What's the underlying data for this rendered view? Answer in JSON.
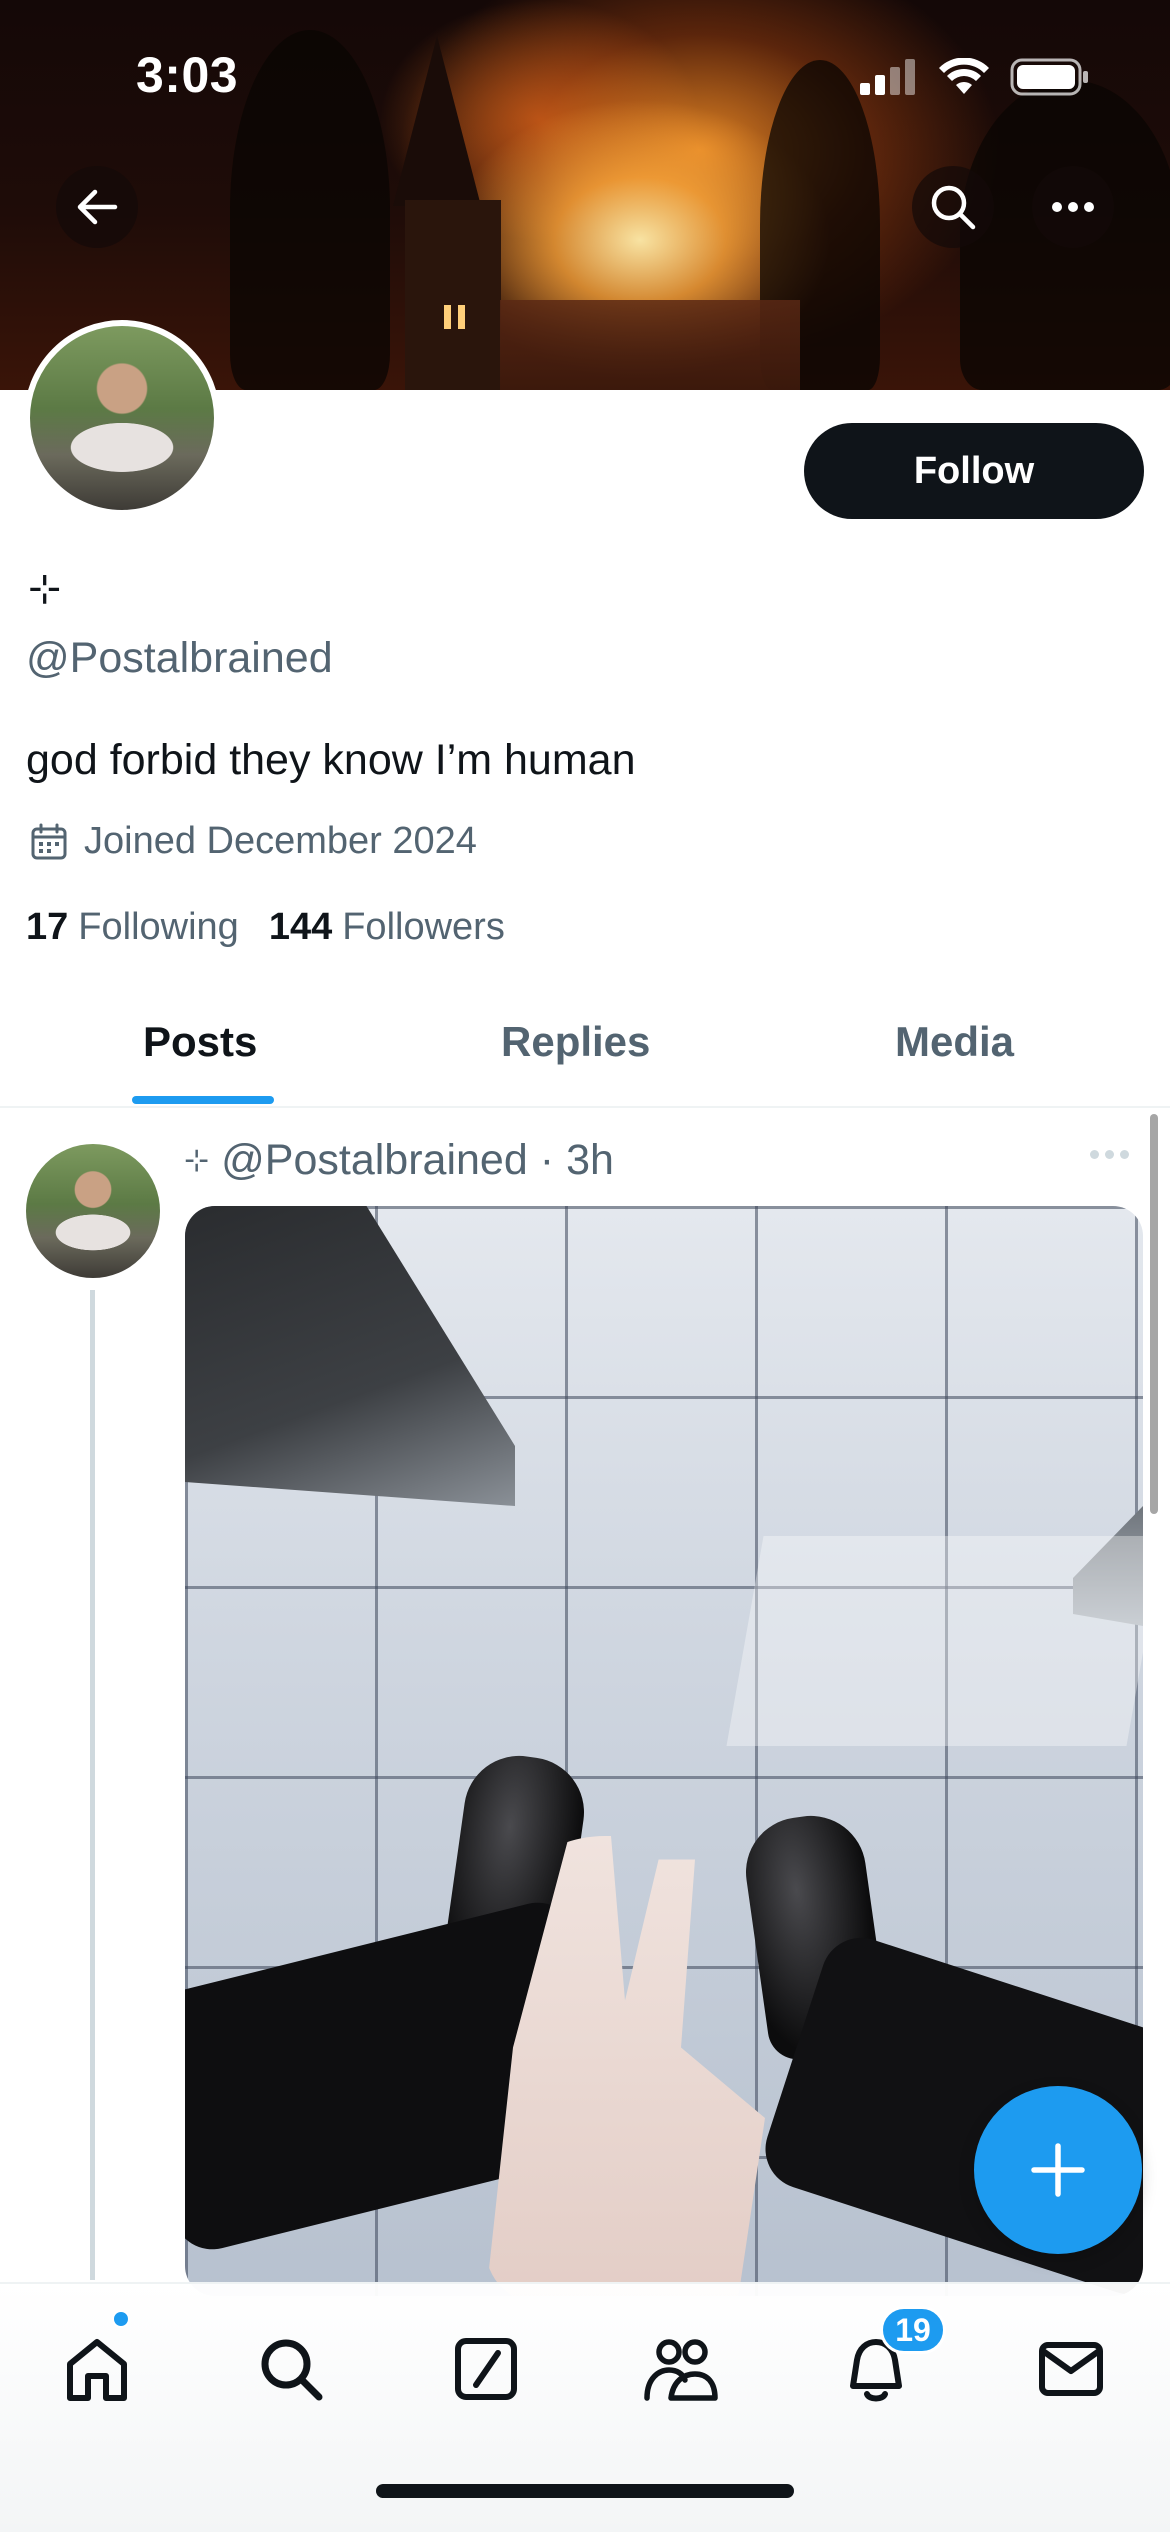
{
  "status_bar": {
    "time": "3:03"
  },
  "profile": {
    "display_name_glyph": "⊹",
    "handle": "@Postalbrained",
    "bio": "god forbid they know I’m human",
    "joined": "Joined December 2024",
    "following_count": "17",
    "following_label": "Following",
    "followers_count": "144",
    "followers_label": "Followers",
    "follow_button_label": "Follow"
  },
  "tabs": [
    {
      "label": "Posts",
      "active": true
    },
    {
      "label": "Replies",
      "active": false
    },
    {
      "label": "Media",
      "active": false
    }
  ],
  "post": {
    "author_glyph": "⊹",
    "author_handle": "@Postalbrained",
    "separator": "·",
    "time_ago": "3h"
  },
  "bottom_nav": {
    "items": [
      "home-icon",
      "search-icon",
      "grok-icon",
      "communities-icon",
      "notifications-icon",
      "messages-icon"
    ],
    "notifications_badge": "19"
  },
  "colors": {
    "accent": "#1d9bf0",
    "text_primary": "#0f1419",
    "text_secondary": "#536471"
  }
}
